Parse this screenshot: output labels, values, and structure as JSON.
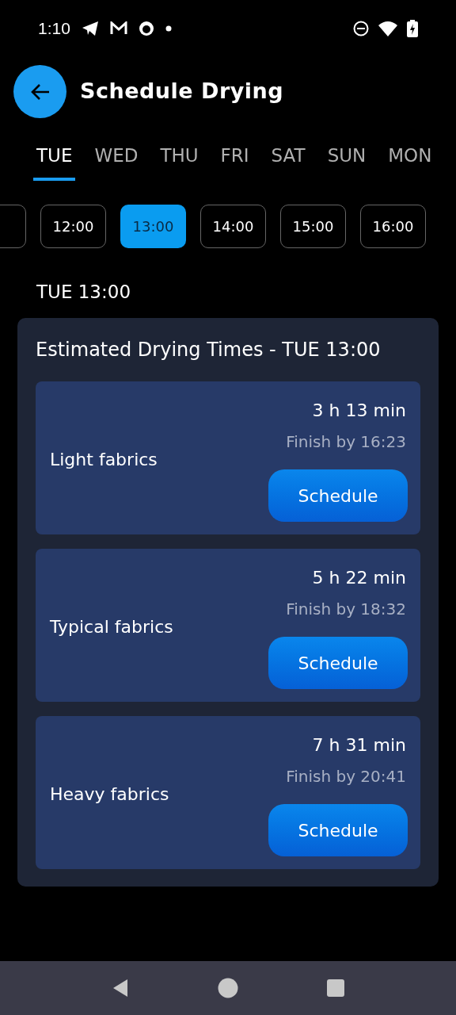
{
  "status_bar": {
    "time": "1:10"
  },
  "header": {
    "title": "Schedule Drying"
  },
  "day_tabs": [
    {
      "label": "TUE",
      "selected": true
    },
    {
      "label": "WED",
      "selected": false
    },
    {
      "label": "THU",
      "selected": false
    },
    {
      "label": "FRI",
      "selected": false
    },
    {
      "label": "SAT",
      "selected": false
    },
    {
      "label": "SUN",
      "selected": false
    },
    {
      "label": "MON",
      "selected": false
    }
  ],
  "time_slots": [
    {
      "label": "12:00",
      "selected": false
    },
    {
      "label": "13:00",
      "selected": true
    },
    {
      "label": "14:00",
      "selected": false
    },
    {
      "label": "15:00",
      "selected": false
    },
    {
      "label": "16:00",
      "selected": false
    }
  ],
  "selected_label": "TUE 13:00",
  "estimates": {
    "title": "Estimated Drying Times - TUE 13:00",
    "items": [
      {
        "fabric": "Light fabrics",
        "duration": "3 h 13 min",
        "finish": "Finish by 16:23",
        "button": "Schedule"
      },
      {
        "fabric": "Typical fabrics",
        "duration": "5 h 22 min",
        "finish": "Finish by 18:32",
        "button": "Schedule"
      },
      {
        "fabric": "Heavy fabrics",
        "duration": "7 h 31 min",
        "finish": "Finish by 20:41",
        "button": "Schedule"
      }
    ]
  }
}
